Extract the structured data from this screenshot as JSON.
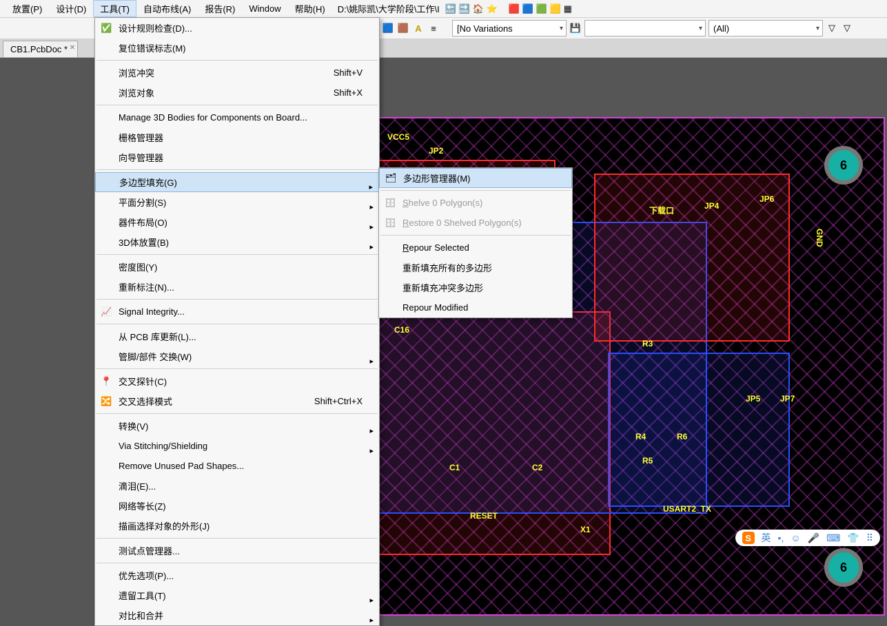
{
  "menubar": {
    "place": "放置(P)",
    "design": "设计(D)",
    "tools": "工具(T)",
    "autoroute": "自动布线(A)",
    "report": "报告(R)",
    "window": "Window",
    "help": "帮助(H)",
    "path": "D:\\姚际凯\\大学阶段\\工作\\I"
  },
  "toolbar": {
    "variations": "[No Variations",
    "all": "(All)"
  },
  "doc": {
    "tab": "CB1.PcbDoc *"
  },
  "tools_menu": {
    "drc": "设计规则检查(D)...",
    "reset_err": "复位错误标志(M)",
    "browse_conflict": "浏览冲突",
    "browse_conflict_sc": "Shift+V",
    "browse_obj": "浏览对象",
    "browse_obj_sc": "Shift+X",
    "manage3d": "Manage 3D Bodies for Components on Board...",
    "grid_mgr": "栅格管理器",
    "guide_mgr": "向导管理器",
    "poly_fill": "多边型填充(G)",
    "plane_split": "平面分割(S)",
    "comp_place": "器件布局(O)",
    "body_place": "3D体放置(B)",
    "density": "密度图(Y)",
    "reannotate": "重新标注(N)...",
    "sig_integ": "Signal Integrity...",
    "update_from_lib": "从 PCB 库更新(L)...",
    "pin_swap": "管脚/部件 交换(W)",
    "cross_probe": "交叉探针(C)",
    "cross_select": "交叉选择模式",
    "cross_select_sc": "Shift+Ctrl+X",
    "convert": "转换(V)",
    "via_stitch": "Via Stitching/Shielding",
    "remove_pad": "Remove Unused Pad Shapes...",
    "teardrop": "滴泪(E)...",
    "net_eq": "网络等长(Z)",
    "outline_sel": "描画选择对象的外形(J)",
    "testpoint": "测试点管理器...",
    "prefs": "优先选项(P)...",
    "legacy": "遗留工具(T)",
    "compare": "对比和合并"
  },
  "poly_menu": {
    "poly_mgr": "多边形管理器(M)",
    "shelve": "Shelve 0 Polygon(s)",
    "restore": "Restore 0 Shelved Polygon(s)",
    "repour_sel": "Repour Selected",
    "repour_all": "重新填充所有的多边形",
    "repour_viol": "重新填充冲突多边形",
    "repour_mod": "Repour Modified"
  },
  "ime": {
    "lang": "英"
  },
  "pcb": {
    "pad_tr": "6",
    "pad_br": "6",
    "l_jp2": "JP2",
    "l_jp4": "JP4",
    "l_jp5": "JP5",
    "l_jp6": "JP6",
    "l_jp7": "JP7",
    "l_dl": "下载口",
    "l_r3": "R3",
    "l_r4": "R4",
    "l_r5": "R5",
    "l_r6": "R6",
    "l_c1": "C1",
    "l_c2": "C2",
    "l_c16": "C16",
    "l_x1": "X1",
    "l_reset": "RESET",
    "l_gnd": "GND",
    "l_vcc": "VCC5",
    "l_usart": "USART2_TX"
  }
}
